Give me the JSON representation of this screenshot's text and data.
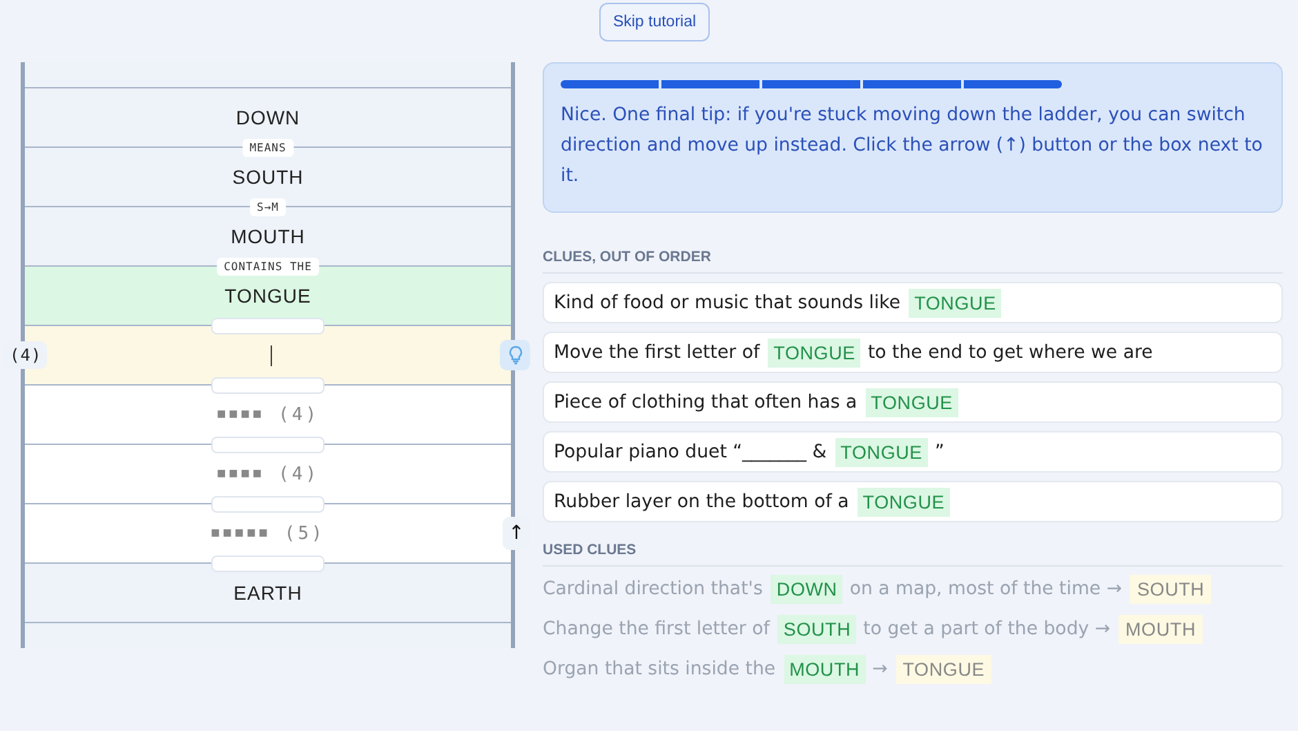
{
  "skip_button": "Skip tutorial",
  "ladder": {
    "rungs": [
      {
        "kind": "blank"
      },
      {
        "kind": "word",
        "text": "DOWN",
        "found": false
      },
      {
        "kind": "word",
        "text": "SOUTH",
        "found": false,
        "link": "MEANS"
      },
      {
        "kind": "word",
        "text": "MOUTH",
        "found": false,
        "link": "S→M"
      },
      {
        "kind": "word",
        "text": "TONGUE",
        "found": true,
        "link": "CONTAINS THE"
      },
      {
        "kind": "input",
        "hint": "(4)",
        "link_slot": true
      },
      {
        "kind": "hidden",
        "squares": "■■■■",
        "count": "(4)",
        "link_slot": true
      },
      {
        "kind": "hidden",
        "squares": "■■■■",
        "count": "(4)",
        "link_slot": true
      },
      {
        "kind": "hidden",
        "squares": "■■■■■",
        "count": "(5)",
        "link_slot": true,
        "switch_button": "↑"
      },
      {
        "kind": "word",
        "text": "EARTH",
        "found": false,
        "link_slot": true
      },
      {
        "kind": "blank"
      }
    ]
  },
  "tip": {
    "steps": [
      {
        "done": true
      },
      {
        "done": true
      },
      {
        "done": true
      },
      {
        "done": true
      },
      {
        "done": true
      }
    ],
    "text": "Nice. One final tip: if you're stuck moving down the ladder, you can switch direction and move up instead. Click the arrow (↑) button or the box next to it."
  },
  "clues": {
    "heading": "CLUES, OUT OF ORDER",
    "items": [
      {
        "before": "Kind of food or music that sounds like",
        "word": "TONGUE"
      },
      {
        "before": "Move the first letter of",
        "word": "TONGUE",
        "after": "to the end to get where we are"
      },
      {
        "before": "Piece of clothing that often has a",
        "word": "TONGUE"
      },
      {
        "before": "Popular piano duet “_______ &",
        "word": "TONGUE",
        "after": "”"
      },
      {
        "before": "Rubber layer on the bottom of a",
        "word": "TONGUE"
      }
    ]
  },
  "used_clues": {
    "heading": "USED CLUES",
    "items": [
      {
        "before": "Cardinal direction that's",
        "word": "DOWN",
        "after": "on a map, most of the time →",
        "answer": "SOUTH"
      },
      {
        "before": "Change the first letter of",
        "word": "SOUTH",
        "after": "to get a part of the body →",
        "answer": "MOUTH"
      },
      {
        "before": "Organ that sits inside the",
        "word": "MOUTH",
        "after": "→",
        "answer": "TONGUE"
      }
    ]
  }
}
